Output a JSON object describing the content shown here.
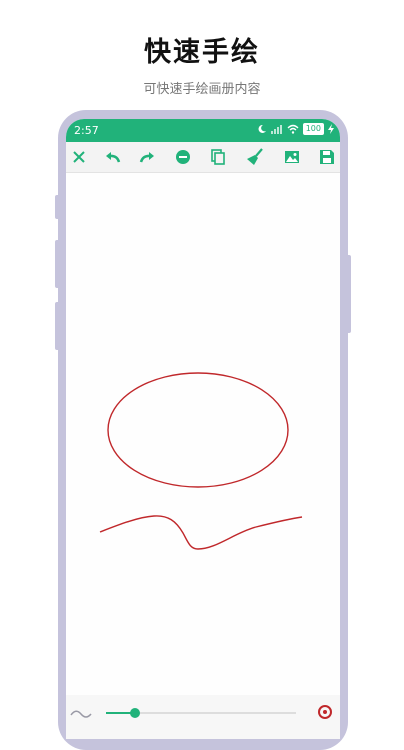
{
  "promo": {
    "headline": "快速手绘",
    "subline": "可快速手绘画册内容"
  },
  "status_bar": {
    "time": "2:57",
    "battery": "100",
    "icons": [
      "moon-icon",
      "signal-icon",
      "wifi-icon",
      "battery-icon",
      "charging-icon"
    ]
  },
  "toolbar": {
    "tools": [
      "close-icon",
      "undo-icon",
      "redo-icon",
      "eraser-icon",
      "copy-icon",
      "clear-brush-icon",
      "image-icon",
      "save-icon"
    ]
  },
  "bottom_bar": {
    "brush_size_fraction": 0.15,
    "icons": [
      "brush-style-icon",
      "color-picker-icon"
    ]
  },
  "colors": {
    "accent": "#21b27a",
    "toolbar_icon": "#21b27a",
    "stroke": "#c0282b",
    "phone_frame": "#c5c3dc"
  }
}
